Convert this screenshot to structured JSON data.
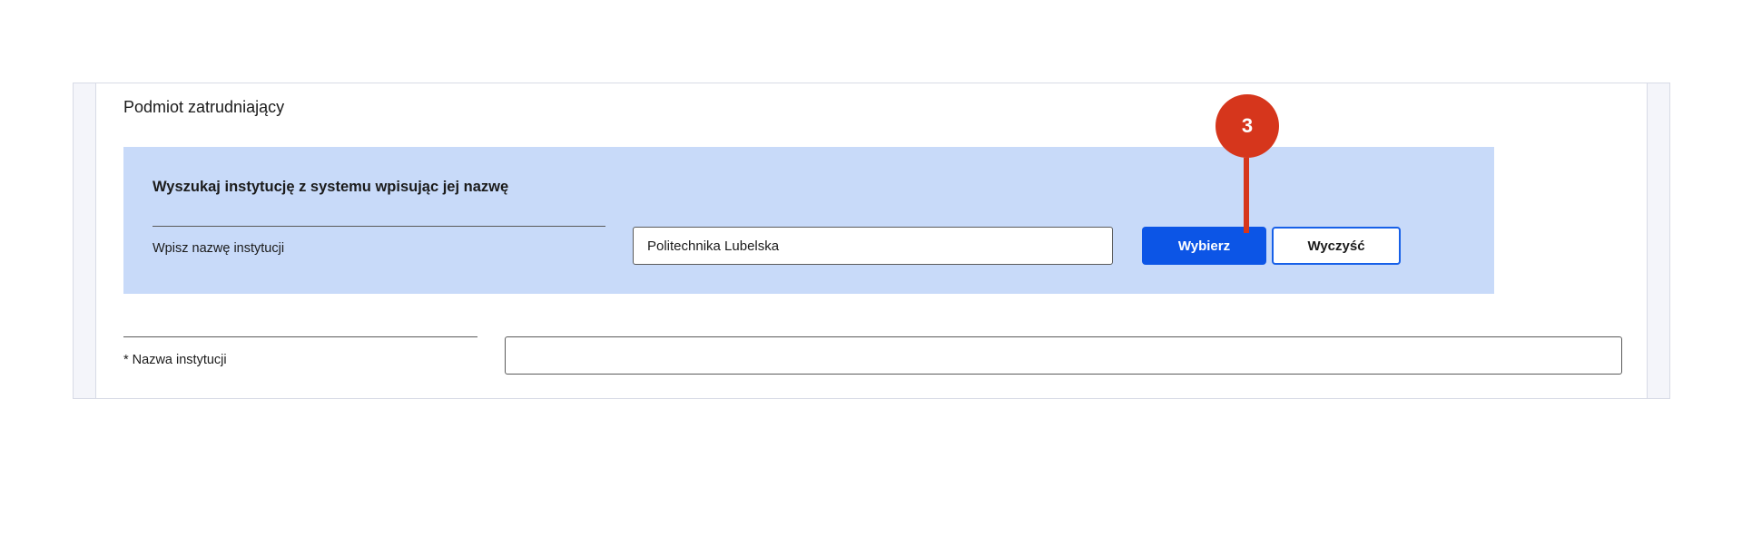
{
  "section": {
    "title": "Podmiot zatrudniający"
  },
  "search": {
    "heading": "Wyszukaj instytucję z systemu wpisując jej nazwę",
    "label": "Wpisz nazwę instytucji",
    "value": "Politechnika Lubelska",
    "select_label": "Wybierz",
    "clear_label": "Wyczyść"
  },
  "institution": {
    "label": "* Nazwa instytucji",
    "value": ""
  },
  "callout": {
    "number": "3",
    "color": "#d6361c"
  },
  "colors": {
    "search_bg": "#c8daf9",
    "primary": "#0c55e6"
  }
}
